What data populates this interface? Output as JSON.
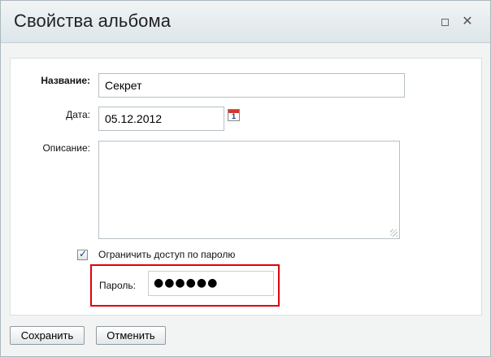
{
  "dialog": {
    "title": "Свойства альбома",
    "maximize_icon": "maximize-icon",
    "close_icon": "close-icon",
    "close_glyph": "✕"
  },
  "form": {
    "name_label": "Название:",
    "name_value": "Секрет",
    "date_label": "Дата:",
    "date_value": "05.12.2012",
    "calendar_icon": "calendar-icon",
    "calendar_day": "1",
    "description_label": "Описание:",
    "description_value": "",
    "restrict_checkbox_label": "Ограничить доступ по паролю",
    "restrict_checked": true,
    "check_glyph": "✓",
    "password_label": "Пароль:",
    "password_masked": "●●●●●●"
  },
  "buttons": {
    "save": "Сохранить",
    "cancel": "Отменить"
  },
  "colors": {
    "highlight_border": "#e2000b",
    "title_bar": "#dde6e9"
  }
}
